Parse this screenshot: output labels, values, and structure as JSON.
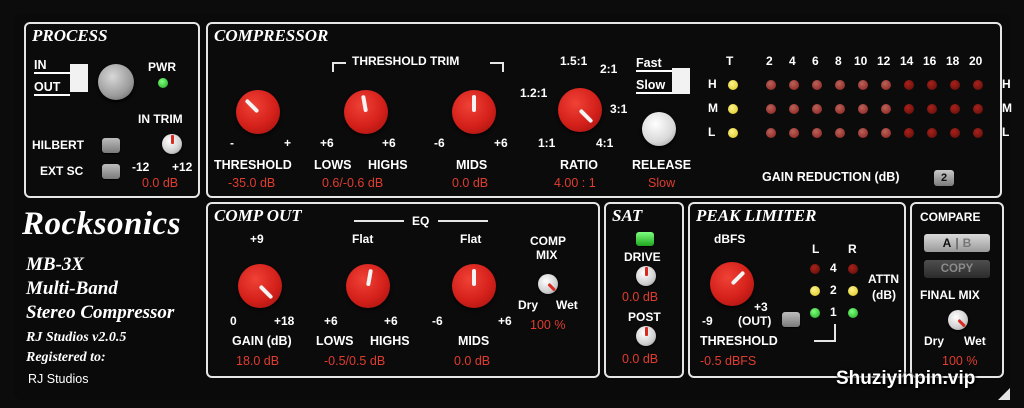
{
  "process": {
    "title": "PROCESS",
    "in_label": "IN",
    "out_label": "OUT",
    "pwr_label": "PWR",
    "in_trim_label": "IN TRIM",
    "hilbert_label": "HILBERT",
    "ext_sc_label": "EXT SC",
    "trim_min": "-12",
    "trim_max": "+12",
    "trim_value": "0.0 dB"
  },
  "compressor": {
    "title": "COMPRESSOR",
    "threshold_trim_label": "THRESHOLD TRIM",
    "threshold": {
      "label": "THRESHOLD",
      "min": "-",
      "max": "+",
      "value": "-35.0 dB"
    },
    "lows_highs": {
      "label_lows": "LOWS",
      "label_highs": "HIGHS",
      "min": "+6",
      "max": "+6",
      "value": "0.6/-0.6 dB"
    },
    "mids": {
      "label": "MIDS",
      "min": "-6",
      "max": "+6",
      "value": "0.0 dB"
    },
    "ratio": {
      "label": "RATIO",
      "r1": "1:1",
      "r12": "1.2:1",
      "r15": "1.5:1",
      "r2": "2:1",
      "r3": "3:1",
      "r4": "4:1",
      "value": "4.00 : 1"
    },
    "release": {
      "label": "RELEASE",
      "fast": "Fast",
      "slow": "Slow",
      "value": "Slow"
    },
    "gain_reduction": {
      "label": "GAIN REDUCTION (dB)",
      "button": "2",
      "t_label": "T",
      "scale": [
        "2",
        "4",
        "6",
        "8",
        "10",
        "12",
        "14",
        "16",
        "18",
        "20"
      ],
      "rows": [
        "H",
        "M",
        "L"
      ]
    }
  },
  "comp_out": {
    "title": "COMP OUT",
    "eq_label": "EQ",
    "gain": {
      "label": "GAIN (dB)",
      "top": "+9",
      "min": "0",
      "max": "+18",
      "value": "18.0 dB"
    },
    "lows_highs": {
      "top": "Flat",
      "label_lows": "LOWS",
      "label_highs": "HIGHS",
      "min": "+6",
      "max": "+6",
      "value": "-0.5/0.5 dB"
    },
    "mids": {
      "top": "Flat",
      "label": "MIDS",
      "min": "-6",
      "max": "+6",
      "value": "0.0 dB"
    },
    "comp_mix": {
      "label1": "COMP",
      "label2": "MIX",
      "dry": "Dry",
      "wet": "Wet",
      "value": "100 %"
    }
  },
  "sat": {
    "title": "SAT",
    "drive": {
      "label": "DRIVE",
      "value": "0.0 dB"
    },
    "post": {
      "label": "POST",
      "value": "0.0 dB"
    }
  },
  "peak_limiter": {
    "title": "PEAK LIMITER",
    "dbfs_label": "dBFS",
    "min": "-9",
    "max": "+3",
    "out_label": "(OUT)",
    "threshold_label": "THRESHOLD",
    "value": "-0.5 dBFS",
    "l_label": "L",
    "r_label": "R",
    "attn_label1": "ATTN",
    "attn_label2": "(dB)",
    "levels": [
      "4",
      "2",
      "1"
    ]
  },
  "compare": {
    "title": "COMPARE",
    "a_label": "A",
    "b_label": "B",
    "copy_label": "COPY",
    "final_mix_label": "FINAL MIX",
    "dry": "Dry",
    "wet": "Wet",
    "value": "100 %"
  },
  "brand": {
    "name": "Rocksonics",
    "model": "MB-3X",
    "line1": "Multi-Band",
    "line2": "Stereo Compressor",
    "version": "RJ Studios v2.0.5",
    "registered": "Registered to:",
    "owner": "RJ Studios"
  },
  "watermark": "Shuziyinpin.vip",
  "colors": {
    "value_red": "#e03c30",
    "knob_red": "#d4201a",
    "led_green": "#2ecc2e"
  }
}
